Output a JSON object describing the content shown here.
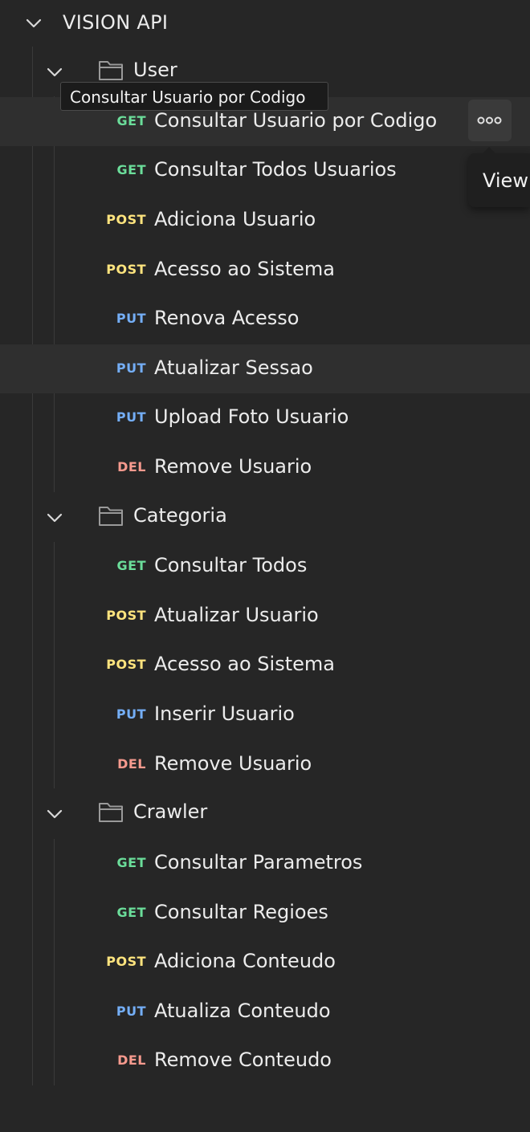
{
  "collection": {
    "title": "VISION API",
    "icons": {
      "expand": "chevron-down-icon",
      "folder": "folder-icon",
      "more": "more-options-icon"
    },
    "method_colors": {
      "GET": "#6bdd9a",
      "POST": "#ffe47e",
      "PUT": "#74aef6",
      "DEL": "#f79a8e"
    },
    "folders": [
      {
        "name": "User",
        "requests": [
          {
            "method": "GET",
            "name": "Consultar Usuario por Codigo"
          },
          {
            "method": "GET",
            "name": "Consultar Todos Usuarios"
          },
          {
            "method": "POST",
            "name": "Adiciona Usuario"
          },
          {
            "method": "POST",
            "name": "Acesso ao Sistema"
          },
          {
            "method": "PUT",
            "name": "Renova Acesso"
          },
          {
            "method": "PUT",
            "name": "Atualizar Sessao"
          },
          {
            "method": "PUT",
            "name": "Upload Foto Usuario"
          },
          {
            "method": "DEL",
            "name": "Remove Usuario"
          }
        ]
      },
      {
        "name": "Categoria",
        "requests": [
          {
            "method": "GET",
            "name": "Consultar Todos"
          },
          {
            "method": "POST",
            "name": "Atualizar Usuario"
          },
          {
            "method": "POST",
            "name": "Acesso ao Sistema"
          },
          {
            "method": "PUT",
            "name": "Inserir Usuario"
          },
          {
            "method": "DEL",
            "name": "Remove Usuario"
          }
        ]
      },
      {
        "name": "Crawler",
        "requests": [
          {
            "method": "GET",
            "name": "Consultar Parametros"
          },
          {
            "method": "GET",
            "name": "Consultar Regioes"
          },
          {
            "method": "POST",
            "name": "Adiciona Conteudo"
          },
          {
            "method": "PUT",
            "name": "Atualiza Conteudo"
          },
          {
            "method": "DEL",
            "name": "Remove Conteudo"
          }
        ]
      }
    ]
  },
  "tooltip": {
    "text": "Consultar Usuario por Codigo"
  },
  "popover": {
    "label": "View"
  }
}
